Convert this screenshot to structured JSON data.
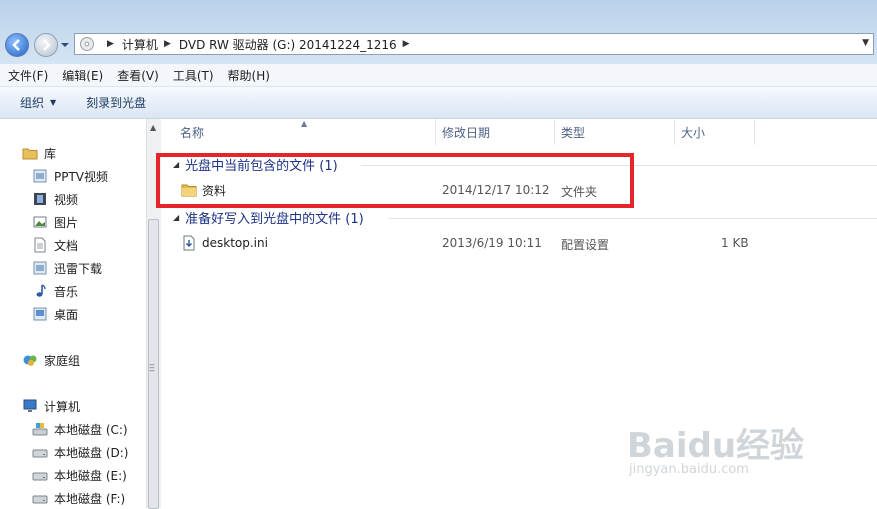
{
  "address": {
    "crumbs": [
      "计算机",
      "DVD RW 驱动器 (G:) 20141224_1216"
    ]
  },
  "menu": [
    "文件(F)",
    "编辑(E)",
    "查看(V)",
    "工具(T)",
    "帮助(H)"
  ],
  "toolbar": {
    "organize": "组织",
    "burn": "刻录到光盘"
  },
  "nav": {
    "library": "库",
    "library_items": [
      "PPTV视频",
      "视频",
      "图片",
      "文档",
      "迅雷下载",
      "音乐",
      "桌面"
    ],
    "homegroup": "家庭组",
    "computer": "计算机",
    "drives": [
      "本地磁盘 (C:)",
      "本地磁盘 (D:)",
      "本地磁盘 (E:)",
      "本地磁盘 (F:)"
    ]
  },
  "columns": {
    "name": "名称",
    "date": "修改日期",
    "type": "类型",
    "size": "大小"
  },
  "groups": [
    {
      "title": "光盘中当前包含的文件 (1)",
      "rows": [
        {
          "name": "资料",
          "date": "2014/12/17 10:12",
          "type": "文件夹",
          "size": "",
          "icon": "folder-icon"
        }
      ]
    },
    {
      "title": "准备好写入到光盘中的文件 (1)",
      "rows": [
        {
          "name": "desktop.ini",
          "date": "2013/6/19 10:11",
          "type": "配置设置",
          "size": "1 KB",
          "icon": "ini-file-icon"
        }
      ]
    }
  ],
  "watermark": {
    "brand": "Baidu经验",
    "url": "jingyan.baidu.com"
  },
  "colors": {
    "highlight": "#e4262b",
    "group_text": "#1e3287"
  }
}
